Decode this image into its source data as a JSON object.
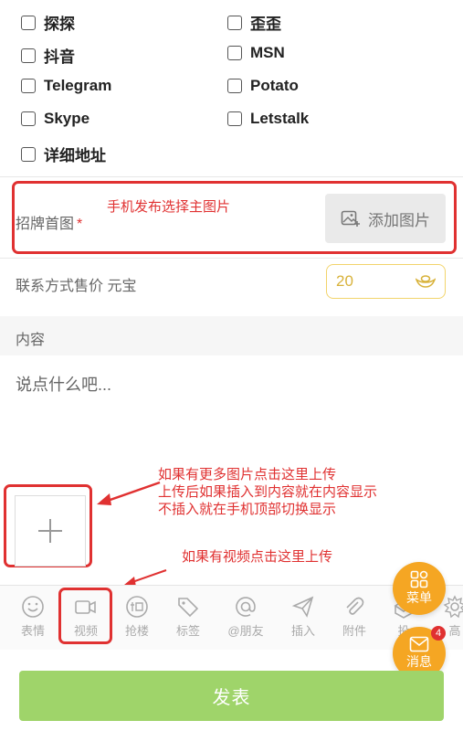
{
  "contacts": [
    "探探",
    "歪歪",
    "抖音",
    "MSN",
    "Telegram",
    "Potato",
    "Skype",
    "Letstalk",
    "详细地址"
  ],
  "signboard": {
    "label": "招牌首图",
    "required_mark": "*",
    "annotation": "手机发布选择主图片",
    "add_image_label": "添加图片"
  },
  "price": {
    "label": "联系方式售价 元宝",
    "value": "20"
  },
  "content": {
    "section_title": "内容",
    "placeholder": "说点什么吧..."
  },
  "annotations": {
    "more_images": [
      "如果有更多图片点击这里上传",
      "上传后如果插入到内容就在内容显示",
      "不插入就在手机顶部切换显示"
    ],
    "video": "如果有视频点击这里上传"
  },
  "toolbar": [
    {
      "label": "表情",
      "icon": "smile-icon"
    },
    {
      "label": "视频",
      "icon": "video-camera-icon"
    },
    {
      "label": "抢楼",
      "icon": "grab-floor-icon"
    },
    {
      "label": "标签",
      "icon": "tag-icon"
    },
    {
      "label": "@朋友",
      "icon": "at-icon"
    },
    {
      "label": "插入",
      "icon": "send-plane-icon"
    },
    {
      "label": "附件",
      "icon": "paperclip-icon"
    },
    {
      "label": "投",
      "icon": "box-icon"
    },
    {
      "label": "高",
      "icon": "gear-icon"
    }
  ],
  "fab": {
    "menu_label": "菜单",
    "message_label": "消息",
    "message_badge": "4"
  },
  "submit_label": "发表",
  "colors": {
    "annotation_red": "#e03131",
    "accent_orange": "#f5a623",
    "submit_green": "#9fd46a",
    "price_gold": "#d8b23a"
  }
}
